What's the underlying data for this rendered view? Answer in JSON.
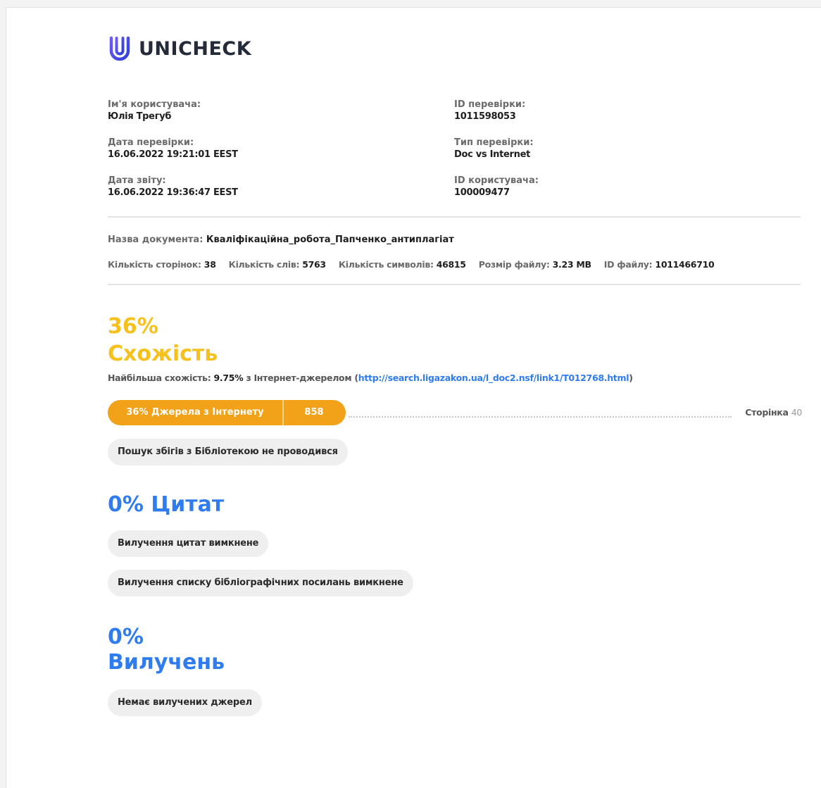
{
  "brand": {
    "name": "UNICHECK",
    "logo_icon": "paperclip-u-icon",
    "accent_color": "#4a4ae0"
  },
  "meta": {
    "left": [
      {
        "label": "Ім'я користувача:",
        "value": "Юлія Трегуб"
      },
      {
        "label": "Дата перевірки:",
        "value": "16.06.2022 19:21:01 EEST"
      },
      {
        "label": "Дата звіту:",
        "value": "16.06.2022 19:36:47 EEST"
      }
    ],
    "right": [
      {
        "label": "ID перевірки:",
        "value": "1011598053"
      },
      {
        "label": "Тип перевірки:",
        "value": "Doc vs Internet"
      },
      {
        "label": "ID користувача:",
        "value": "100009477"
      }
    ]
  },
  "document": {
    "name_label": "Назва документа:",
    "name_value": "Кваліфікаційна_робота_Папченко_антиплагіат",
    "pages_label": "Кількість сторінок:",
    "pages_value": "38",
    "words_label": "Кількість слів:",
    "words_value": "5763",
    "chars_label": "Кількість символів:",
    "chars_value": "46815",
    "size_label": "Розмір файлу:",
    "size_value": "3.23 MB",
    "fileid_label": "ID файлу:",
    "fileid_value": "1011466710"
  },
  "similarity": {
    "percent": "36%",
    "title": "Схожість",
    "top_label": "Найбільша схожість:",
    "top_value": "9.75%",
    "top_source": "з Інтернет-джерелом",
    "top_link": "http://search.ligazakon.ua/l_doc2.nsf/link1/T012768.html",
    "bar_label": "36% Джерела з Інтернету",
    "bar_count": "858",
    "bar_fraction": 0.36,
    "page_label": "Сторінка",
    "page_number": "40",
    "library_note": "Пошук збігів з Бібліотекою не проводився",
    "color": "#f6c11c",
    "bar_color": "#f2a219"
  },
  "quotes": {
    "title": "0% Цитат",
    "chip1": "Вилучення цитат вимкнене",
    "chip2": "Вилучення списку бібліографічних посилань вимкнене",
    "color": "#2f7cf0"
  },
  "exclusions": {
    "percent": "0%",
    "title": "Вилучень",
    "chip": "Немає вилучених джерел"
  }
}
